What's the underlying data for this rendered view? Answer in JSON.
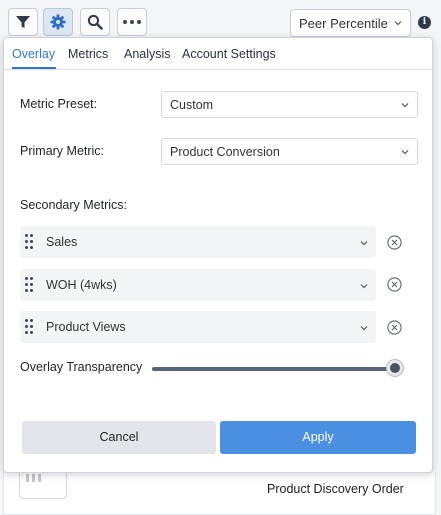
{
  "toolbar": {
    "buttons": [
      {
        "icon": "filter-icon",
        "active": false
      },
      {
        "icon": "gear-icon",
        "active": true
      },
      {
        "icon": "search-icon",
        "active": false
      },
      {
        "icon": "more-icon",
        "active": false
      }
    ],
    "view_select": {
      "value": "Peer Percentile"
    },
    "info_icon": "info-icon"
  },
  "overlay_panel": {
    "tabs": [
      {
        "label": "Overlay",
        "active": true
      },
      {
        "label": "Metrics",
        "active": false
      },
      {
        "label": "Analysis",
        "active": false
      },
      {
        "label": "Account Settings",
        "active": false
      }
    ],
    "metric_preset": {
      "label": "Metric Preset:",
      "value": "Custom"
    },
    "primary_metric": {
      "label": "Primary Metric:",
      "value": "Product Conversion"
    },
    "secondary_metrics": {
      "label": "Secondary Metrics:",
      "items": [
        "Sales",
        "WOH (4wks)",
        "Product Views"
      ]
    },
    "overlay_transparency": {
      "label": "Overlay Transparency",
      "value": 1.0
    },
    "buttons": {
      "cancel": "Cancel",
      "apply": "Apply"
    }
  },
  "background": {
    "card_title": "Product Discovery Order"
  },
  "colors": {
    "accent": "#3377cc",
    "apply_button": "#4a8fe0",
    "cancel_button": "#e4e5ea",
    "active_tool_button": "#dde6f3"
  }
}
